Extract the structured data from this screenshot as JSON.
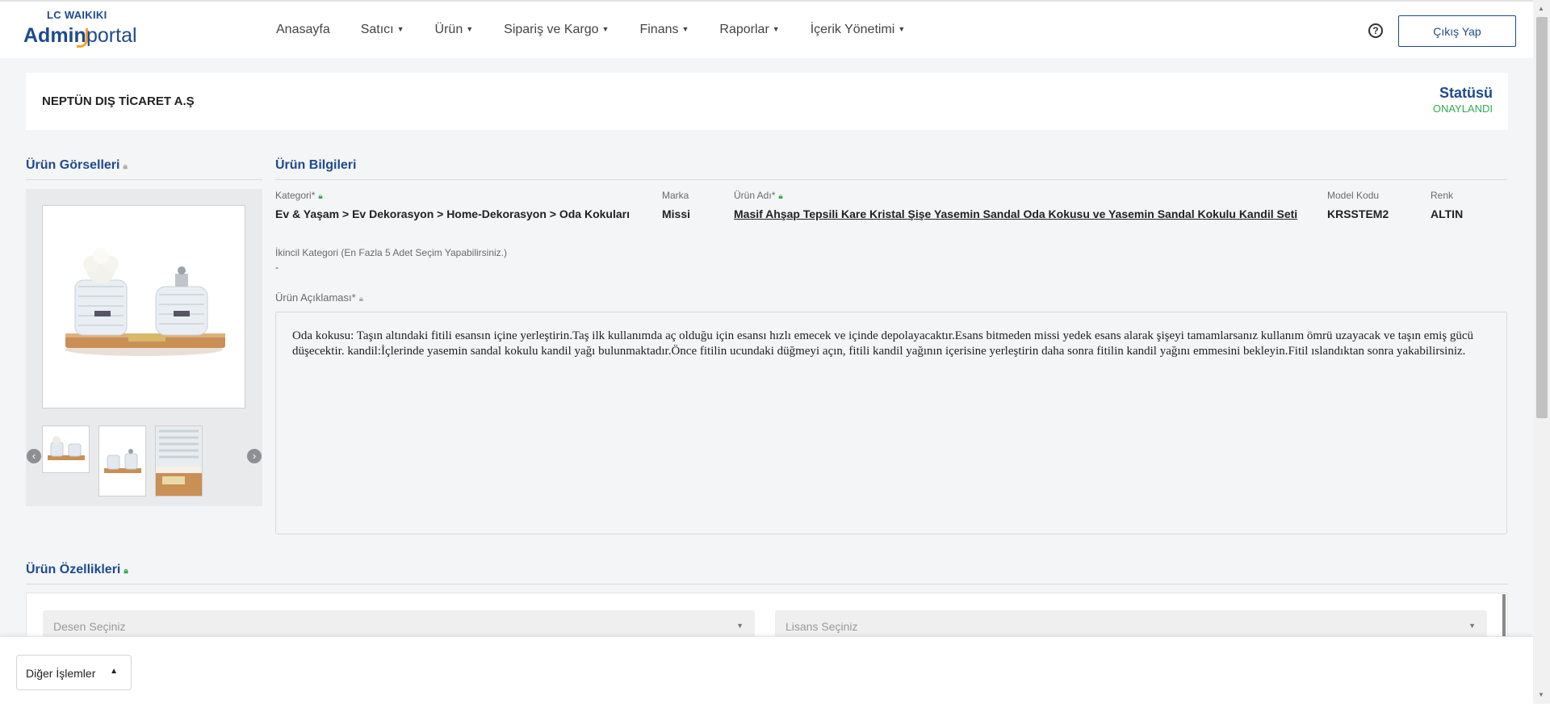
{
  "header": {
    "brand": "LC WAIKIKI",
    "logo_admin": "Admin",
    "logo_portal": "portal",
    "nav": [
      {
        "label": "Anasayfa",
        "dropdown": false
      },
      {
        "label": "Satıcı",
        "dropdown": true
      },
      {
        "label": "Ürün",
        "dropdown": true
      },
      {
        "label": "Sipariş ve Kargo",
        "dropdown": true
      },
      {
        "label": "Finans",
        "dropdown": true
      },
      {
        "label": "Raporlar",
        "dropdown": true
      },
      {
        "label": "İçerik Yönetimi",
        "dropdown": true
      }
    ],
    "help_icon": "question-circle-icon",
    "logout_label": "Çıkış Yap"
  },
  "seller": {
    "name": "NEPTÜN DIŞ TİCARET A.Ş",
    "status_label": "Statüsü",
    "status_value": "ONAYLANDI",
    "status_color": "#2eae4f"
  },
  "gallery": {
    "title": "Ürün Görselleri",
    "thumbnail_count": 3
  },
  "info": {
    "title": "Ürün Bilgileri",
    "category_label": "Kategori*",
    "category_value": "Ev & Yaşam > Ev Dekorasyon > Home-Dekorasyon > Oda Kokuları",
    "brand_label": "Marka",
    "brand_value": "Missi",
    "name_label": "Ürün Adı*",
    "name_value": "Masif Ahşap Tepsili Kare Kristal Şişe Yasemin Sandal Oda Kokusu ve Yasemin Sandal Kokulu Kandil Seti",
    "model_label": "Model Kodu",
    "model_value": "KRSSTEM2",
    "color_label": "Renk",
    "color_value": "ALTIN",
    "secondary_label": "İkincil Kategori (En Fazla 5 Adet Seçim Yapabilirsiniz.)",
    "secondary_value": "-",
    "desc_label": "Ürün Açıklaması*",
    "desc_text": "Oda kokusu: Taşın altındaki fitili esansın içine yerleştirin.Taş ilk kullanımda aç olduğu için esansı hızlı emecek ve içinde depolayacaktır.Esans bitmeden missi yedek esans alarak şişeyi tamamlarsanız kullanım ömrü uzayacak ve taşın emiş gücü düşecektir. kandil:İçlerinde yasemin sandal kokulu kandil yağı bulunmaktadır.Önce fitilin ucundaki düğmeyi açın, fitili kandil yağının içerisine yerleştirin daha sonra fitilin kandil yağını emmesini bekleyin.Fitil ıslandıktan sonra yakabilirsiniz."
  },
  "features": {
    "title": "Ürün Özellikleri",
    "pattern_placeholder": "Desen Seçiniz",
    "license_placeholder": "Lisans Seçiniz"
  },
  "footer": {
    "more_actions_label": "Diğer İşlemler"
  },
  "colors": {
    "accent": "#1d4a8f",
    "logo_accent": "#f5a623",
    "success": "#2eae4f"
  }
}
